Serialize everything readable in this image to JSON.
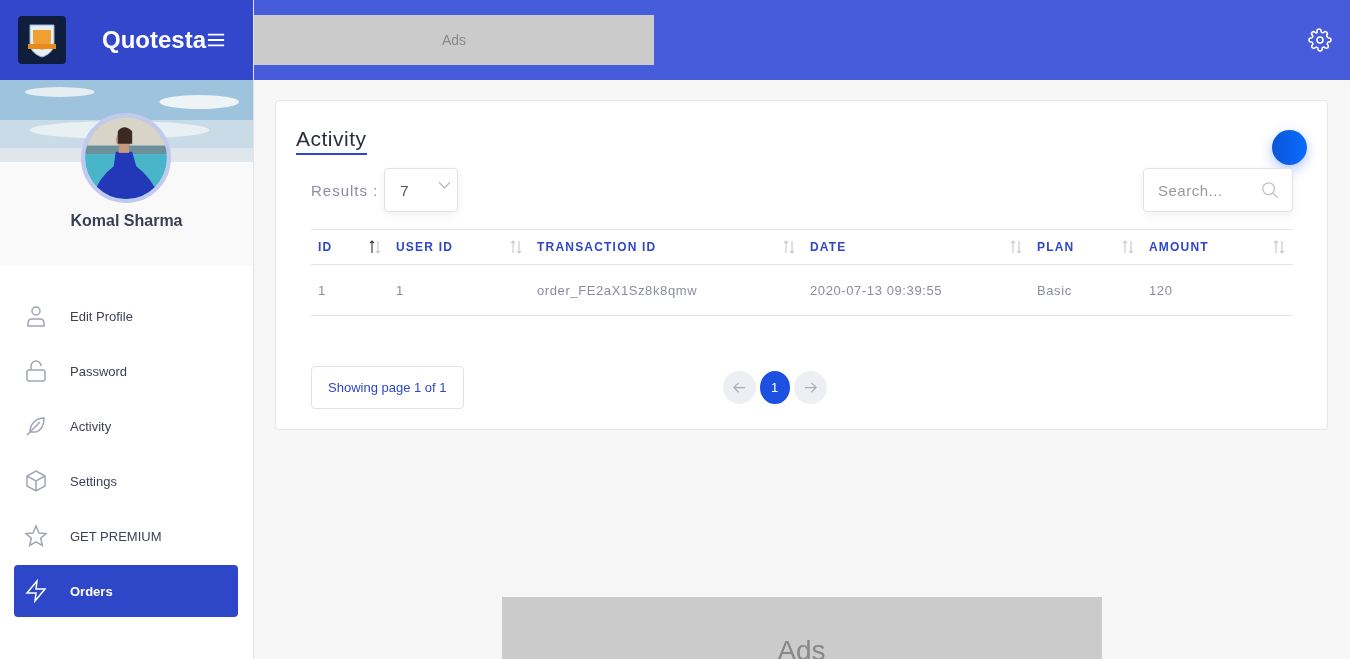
{
  "brand": {
    "name": "Quotesta"
  },
  "header": {
    "ad_label": "Ads"
  },
  "profile": {
    "name": "Komal Sharma"
  },
  "menu": [
    {
      "label": "Edit Profile",
      "kind": "user",
      "selected": false
    },
    {
      "label": "Password",
      "kind": "lock",
      "selected": false
    },
    {
      "label": "Activity",
      "kind": "feather",
      "selected": false
    },
    {
      "label": "Settings",
      "kind": "box",
      "selected": false
    },
    {
      "label": "GET PREMIUM",
      "kind": "star",
      "selected": false
    },
    {
      "label": "Orders",
      "kind": "bolt",
      "selected": true
    }
  ],
  "card": {
    "title": "Activity",
    "results_label": "Results :",
    "results_value": "7",
    "search": {
      "placeholder": "Search..."
    }
  },
  "table": {
    "columns": [
      {
        "label": "ID",
        "sorted": true
      },
      {
        "label": "USER ID",
        "sorted": false
      },
      {
        "label": "TRANSACTION ID",
        "sorted": false
      },
      {
        "label": "DATE",
        "sorted": false
      },
      {
        "label": "PLAN",
        "sorted": false
      },
      {
        "label": "AMOUNT",
        "sorted": false
      }
    ],
    "rows": [
      [
        "1",
        "1",
        "order_FE2aX1Sz8k8qmw",
        "2020-07-13 09:39:55",
        "Basic",
        "120"
      ]
    ]
  },
  "pagination": {
    "status": "Showing page 1 of 1",
    "pages": [
      {
        "label": "1",
        "selected": true
      }
    ]
  },
  "bottom_ad": {
    "label": "Ads"
  }
}
